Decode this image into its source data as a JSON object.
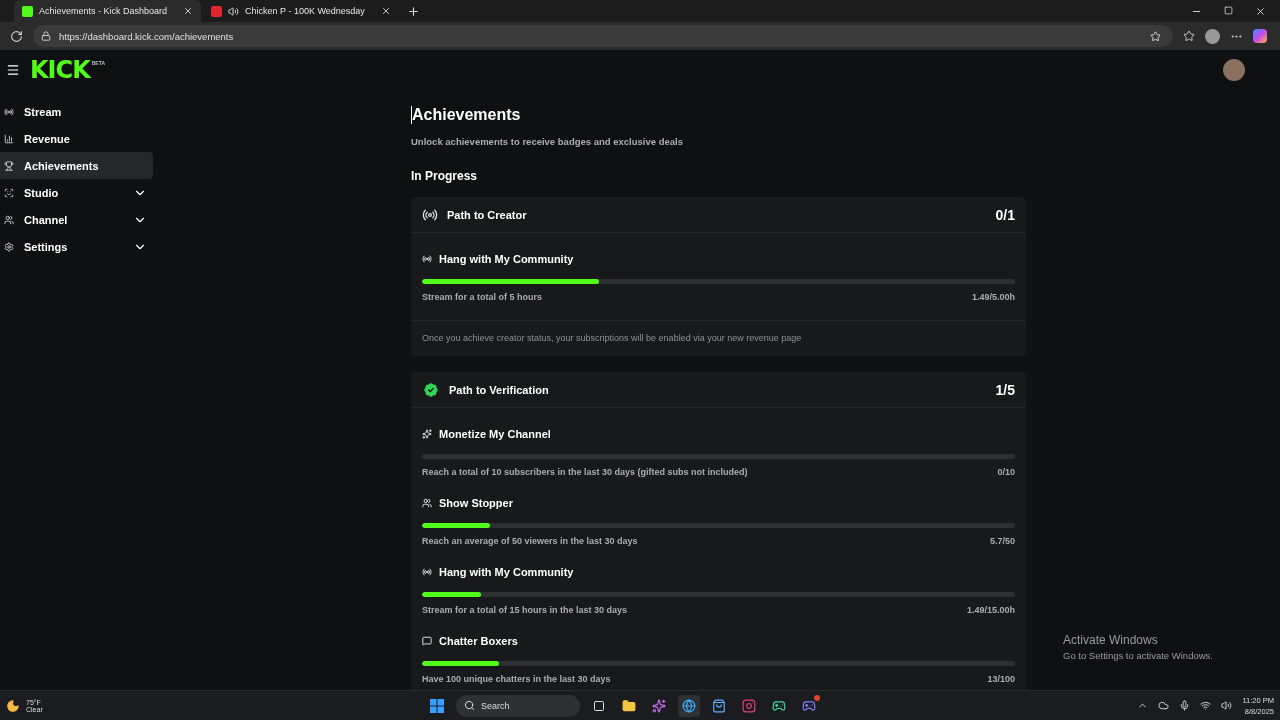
{
  "browser": {
    "tabs": [
      {
        "label": "Achievements - Kick Dashboard",
        "selected": true,
        "audio": false
      },
      {
        "label": "Chicken P - 100K Wednesday",
        "selected": false,
        "audio": true
      }
    ],
    "address": "https://dashboard.kick.com/achievements"
  },
  "header": {
    "logo": "KICK",
    "logo_badge": "BETA"
  },
  "sidebar": {
    "items": [
      {
        "label": "Stream",
        "selected": false
      },
      {
        "label": "Revenue",
        "selected": false
      },
      {
        "label": "Achievements",
        "selected": true
      },
      {
        "label": "Studio",
        "selected": false,
        "expanded": false
      },
      {
        "label": "Channel",
        "selected": false,
        "expanded": false
      },
      {
        "label": "Settings",
        "selected": false,
        "expanded": false
      }
    ]
  },
  "page": {
    "title": "Achievements",
    "subtitle": "Unlock achievements to receive badges and exclusive deals",
    "section": "In Progress"
  },
  "paths": [
    {
      "title": "Path to Creator",
      "progress": "0/1",
      "achievements": [
        {
          "title": "Hang with My Community",
          "description": "Stream for a total of 5 hours",
          "reading": "1.49/5.00h",
          "level": 0.298
        }
      ],
      "note": "Once you achieve creator status, your subscriptions will be enabled via your new revenue page"
    },
    {
      "title": "Path to Verification",
      "progress": "1/5",
      "achievements": [
        {
          "title": "Monetize My Channel",
          "description": "Reach a total of 10 subscribers in the last 30 days (gifted subs not included)",
          "reading": "0/10",
          "level": 0
        },
        {
          "title": "Show Stopper",
          "description": "Reach an average of 50 viewers in the last 30 days",
          "reading": "5.7/50",
          "level": 0.114
        },
        {
          "title": "Hang with My Community",
          "description": "Stream for a total of 15 hours in the last 30 days",
          "reading": "1.49/15.00h",
          "level": 0.099
        },
        {
          "title": "Chatter Boxers",
          "description": "Have 100 unique chatters in the last 30 days",
          "reading": "13/100",
          "level": 0.13
        }
      ]
    }
  ],
  "activation": {
    "title": "Activate Windows",
    "text": "Go to Settings to activate Windows."
  },
  "taskbar": {
    "temperature": "75°F",
    "weather": "Clear",
    "search_placeholder": "Search",
    "time": "11:20 PM",
    "date": "8/8/2025"
  }
}
